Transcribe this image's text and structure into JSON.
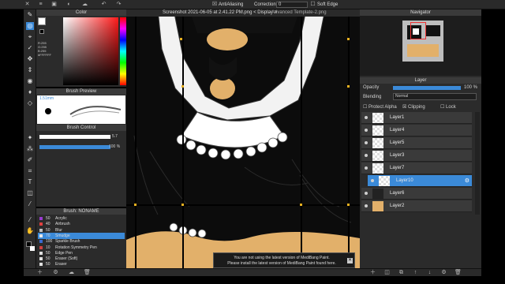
{
  "topbar": {
    "antialiasing_label": "AntiAliasing",
    "correction_label": "Correction",
    "correction_value": "0",
    "soft_edge_label": "Soft Edge",
    "tab_active": "Screenshot 2021-06-05 at 2.41.22 PM.png < Display >",
    "tab_other": "Advanced Template-2.png"
  },
  "color_panel": {
    "title": "Color",
    "values": [
      "R:255",
      "G:255",
      "B:255",
      "#FFFFFF"
    ],
    "main_color": "#ffffff",
    "sub_color": "#000000"
  },
  "brush_preview": {
    "title": "Brush Preview",
    "size_label": "1.51mm"
  },
  "brush_control": {
    "title": "Brush Control",
    "size_value": "5.7",
    "opacity_value": "100 %"
  },
  "brush_list": {
    "title": "Brush: NONAME",
    "items": [
      {
        "size": "50",
        "name": "Acrylic",
        "color": "#9a3ad0"
      },
      {
        "size": "40",
        "name": "Airbrush",
        "color": "#e04040"
      },
      {
        "size": "50",
        "name": "Blur",
        "color": "#c0c0c0"
      },
      {
        "size": "70",
        "name": "Smudge",
        "color": "#e8e8e8"
      },
      {
        "size": "100",
        "name": "Sparkle Brush",
        "color": "#3a6ad0"
      },
      {
        "size": "10",
        "name": "Rotation Symmetry Pen",
        "color": "#d04040"
      },
      {
        "size": "50",
        "name": "Edge Pen",
        "color": "#e0e0e0"
      },
      {
        "size": "50",
        "name": "Eraser (Soft)",
        "color": "#e0e0e0"
      },
      {
        "size": "50",
        "name": "Eraser",
        "color": "#e0e0e0"
      }
    ],
    "selected_index": 3
  },
  "navigator": {
    "title": "Navigator"
  },
  "layer_panel": {
    "title": "Layer",
    "opacity_label": "Opacity",
    "opacity_value": "100 %",
    "opacity_fraction": 1.0,
    "blending_label": "Blending",
    "blending_value": "Normal",
    "protect_alpha": "Protect Alpha",
    "clipping": "Clipping",
    "lock": "Lock",
    "layers": [
      "Layer1",
      "Layer4",
      "Layer5",
      "Layer3",
      "Layer7",
      "Layer10",
      "Layer6",
      "Layer2"
    ],
    "selected_layer": "Layer10"
  },
  "notice": {
    "line1": "You are not using the latest version of MediBang Paint.",
    "line2": "Please install the latest version of MediBang Paint found here."
  },
  "colors": {
    "accent": "#3b8ad8",
    "skin": "#e2b06a",
    "black": "#0c0c0c"
  }
}
